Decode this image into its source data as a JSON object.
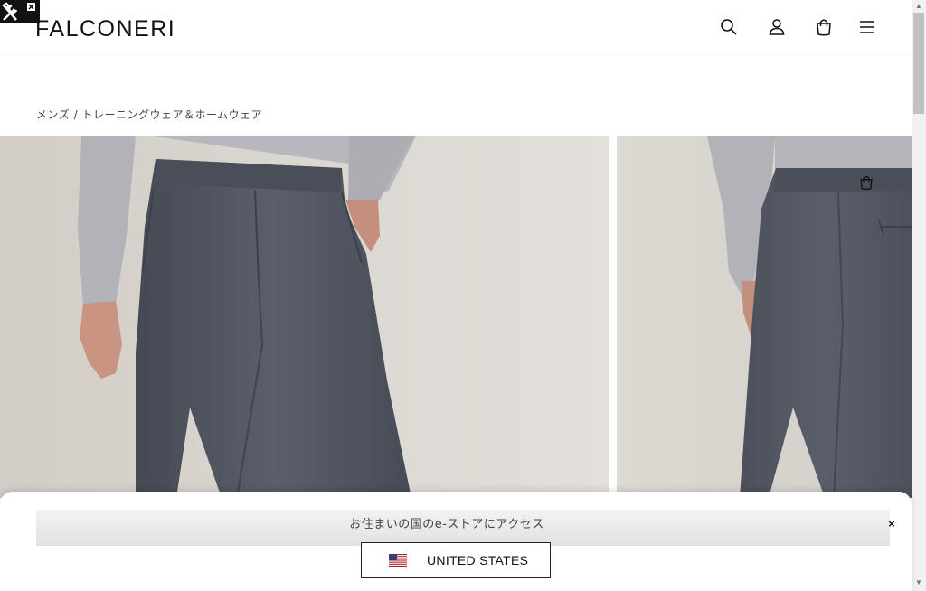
{
  "header": {
    "logo": "FALCONERI",
    "icons": [
      "search-icon",
      "account-icon",
      "bag-icon",
      "menu-icon"
    ]
  },
  "breadcrumb": {
    "items": [
      "メンズ",
      "トレーニングウェア＆ホームウェア"
    ],
    "separator": " / "
  },
  "gallery": {
    "images": [
      "product-front-image",
      "product-back-image"
    ]
  },
  "country_selector": {
    "prompt": "お住まいの国のe-ストアにアクセス",
    "country": "UNITED STATES",
    "close": "×"
  },
  "colors": {
    "background": "#ffffff",
    "banner": "#e8e8e8",
    "text": "#222222",
    "trousers": "#505561",
    "sweater": "#b3b2b8"
  }
}
